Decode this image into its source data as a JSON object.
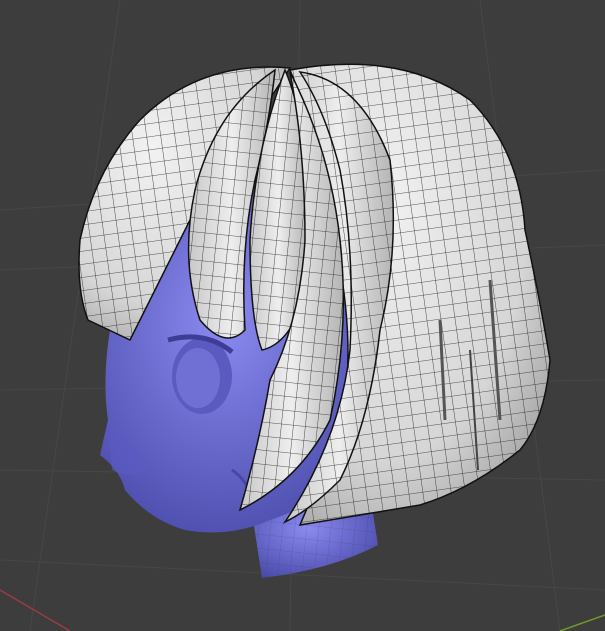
{
  "viewport": {
    "background": "#3d3d3d",
    "grid_color": "#4a4a4a",
    "axis_x_color": "#9c3a44",
    "axis_y_color": "#6a9a2a"
  },
  "model": {
    "head_color": "#7272d8",
    "head_shadow": "#4f4fb3",
    "hair_color": "#dcdcdc",
    "hair_shadow": "#9e9e9e",
    "wire_color": "#1b1b1b"
  }
}
